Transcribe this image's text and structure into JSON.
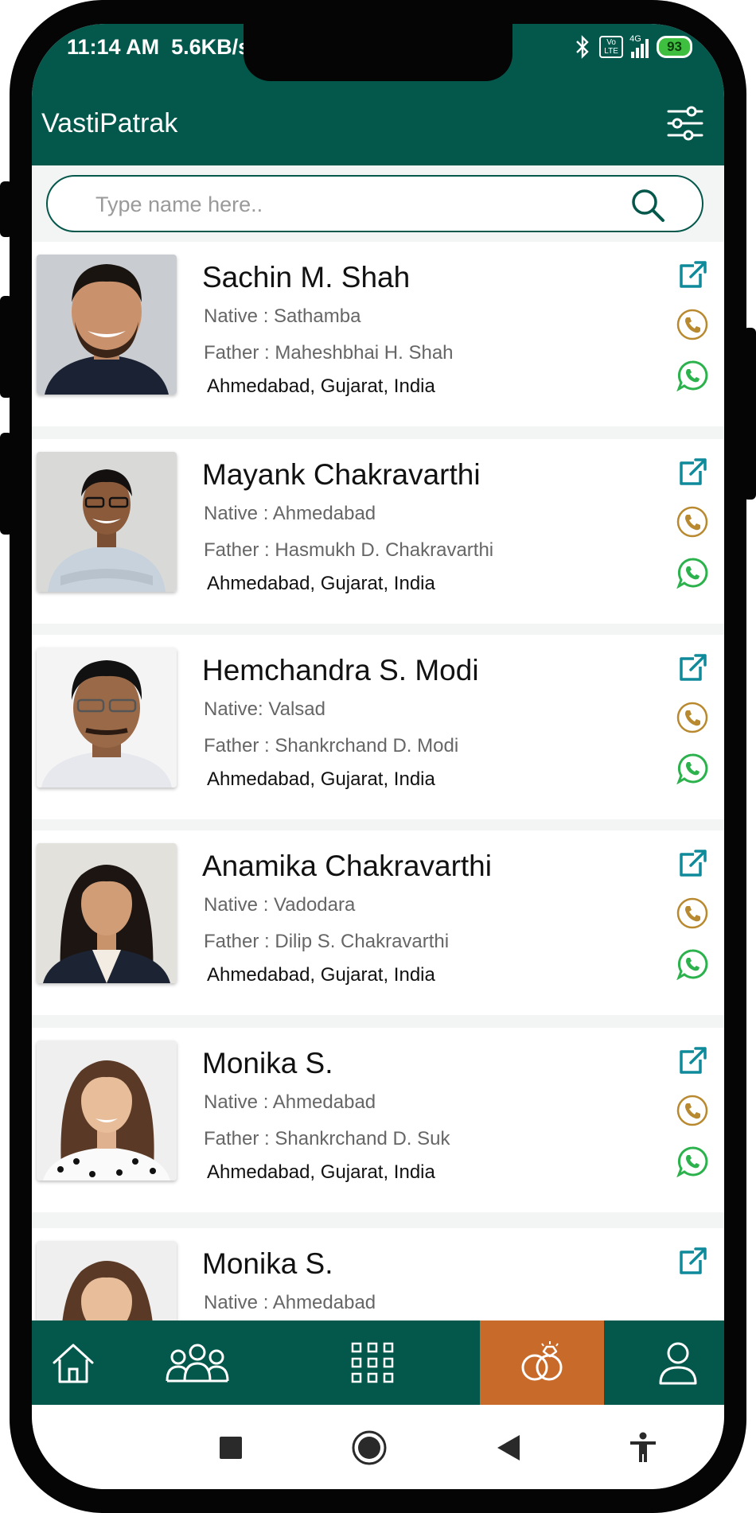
{
  "status_bar": {
    "time": "11:14 AM",
    "speed": "5.6KB/s",
    "network": "4G",
    "volte": "Vo LTE",
    "battery": "93"
  },
  "header": {
    "title": "VastiPatrak"
  },
  "search": {
    "placeholder": "Type name here.."
  },
  "people": [
    {
      "name": "Sachin M. Shah",
      "native": "Native : Sathamba",
      "father": "Father : Maheshbhai H. Shah",
      "location": "Ahmedabad, Gujarat, India"
    },
    {
      "name": "Mayank Chakravarthi",
      "native": "Native : Ahmedabad",
      "father": "Father : Hasmukh D. Chakravarthi",
      "location": "Ahmedabad, Gujarat, India"
    },
    {
      "name": "Hemchandra S. Modi",
      "native": "Native: Valsad",
      "father": "Father : Shankrchand D. Modi",
      "location": "Ahmedabad, Gujarat, India"
    },
    {
      "name": "Anamika Chakravarthi",
      "native": "Native : Vadodara",
      "father": "Father : Dilip S. Chakravarthi",
      "location": "Ahmedabad, Gujarat, India"
    },
    {
      "name": "Monika S.",
      "native": "Native : Ahmedabad",
      "father": "Father : Shankrchand D. Suk",
      "location": "Ahmedabad, Gujarat, India"
    },
    {
      "name": "Monika S.",
      "native": "Native : Ahmedabad",
      "father": "",
      "location": ""
    }
  ],
  "bottom_nav": {
    "items": [
      "home-icon",
      "community-icon",
      "grid-icon",
      "rings-icon",
      "profile-icon"
    ],
    "active": "rings-icon"
  },
  "colors": {
    "primary": "#04574b",
    "accent": "#c86a2a",
    "link_icon": "#0f8a9a",
    "call_icon": "#b8892e",
    "whatsapp_icon": "#2bb24c"
  }
}
